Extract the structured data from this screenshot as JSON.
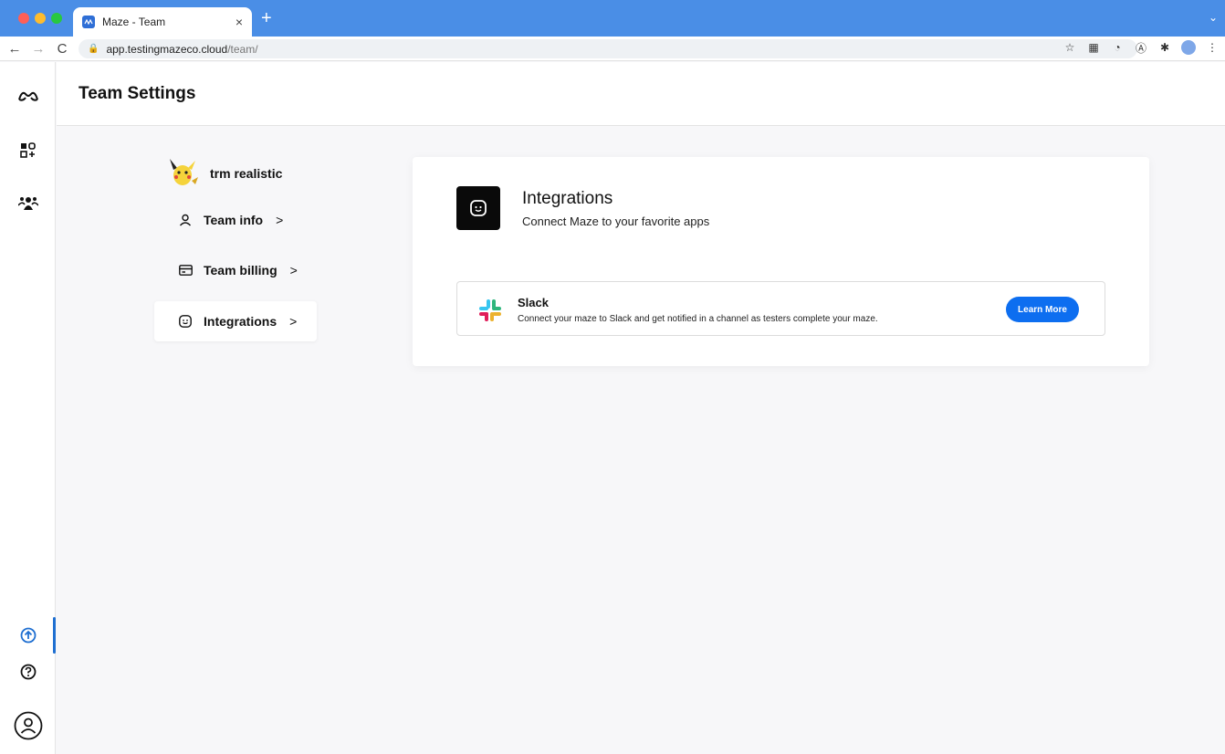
{
  "browser": {
    "tab_title": "Maze - Team",
    "tab_close": "×",
    "new_tab": "+",
    "url_host": "app.testingmazeco.cloud",
    "url_path": "/team/"
  },
  "header": {
    "title": "Team Settings"
  },
  "team": {
    "name": "trm realistic"
  },
  "settings_nav": {
    "items": [
      {
        "label": "Team info",
        "chevron": ">",
        "active": false
      },
      {
        "label": "Team billing",
        "chevron": ">",
        "active": false
      },
      {
        "label": "Integrations",
        "chevron": ">",
        "active": true
      }
    ]
  },
  "integrations": {
    "title": "Integrations",
    "subtitle": "Connect Maze to your favorite apps",
    "items": [
      {
        "name": "Slack",
        "description": "Connect your maze to Slack and get notified in a channel as testers complete your maze.",
        "button_label": "Learn More"
      }
    ]
  },
  "colors": {
    "accent": "#0d6ef0",
    "tabbar": "#4a8ee6",
    "rail_indicator": "#1f6fd1"
  }
}
